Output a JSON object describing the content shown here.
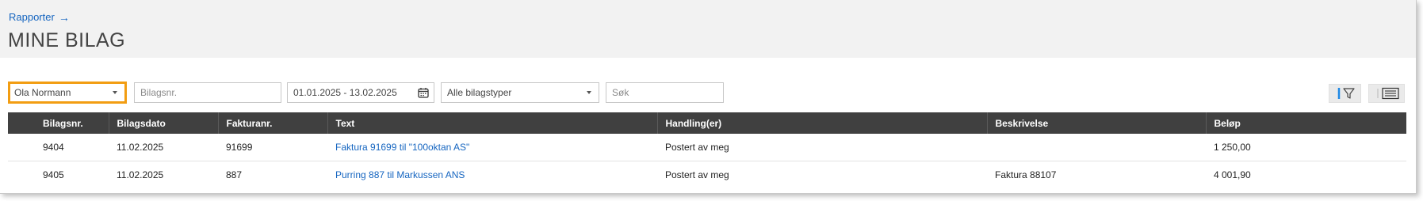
{
  "breadcrumb": {
    "label": "Rapporter",
    "arrow": "→"
  },
  "page_title": "MINE BILAG",
  "filters": {
    "user_select": {
      "value": "Ola Normann"
    },
    "voucher_no": {
      "placeholder": "Bilagsnr."
    },
    "date_range": {
      "value": "01.01.2025 - 13.02.2025"
    },
    "voucher_type": {
      "value": "Alle bilagstyper"
    },
    "search": {
      "placeholder": "Søk"
    }
  },
  "toolbar": {
    "filter_icon": "filter-icon",
    "list_icon": "list-view-icon"
  },
  "table": {
    "columns": [
      "Bilagsnr.",
      "Bilagsdato",
      "Fakturanr.",
      "Text",
      "Handling(er)",
      "Beskrivelse",
      "Beløp"
    ],
    "rows": [
      {
        "bilagsnr": "9404",
        "bilagsdato": "11.02.2025",
        "fakturanr": "91699",
        "text": "Faktura 91699 til \"100oktan AS\"",
        "handling": "Postert av meg",
        "beskrivelse": "",
        "belop": "1 250,00"
      },
      {
        "bilagsnr": "9405",
        "bilagsdato": "11.02.2025",
        "fakturanr": "887",
        "text": "Purring 887 til Markussen ANS",
        "handling": "Postert av meg",
        "beskrivelse": "Faktura 88107",
        "belop": "4 001,90"
      }
    ]
  },
  "colors": {
    "accent_focus": "#f29d12",
    "link": "#1565c0",
    "table_header": "#404040",
    "header_bg": "#f2f2f2"
  }
}
